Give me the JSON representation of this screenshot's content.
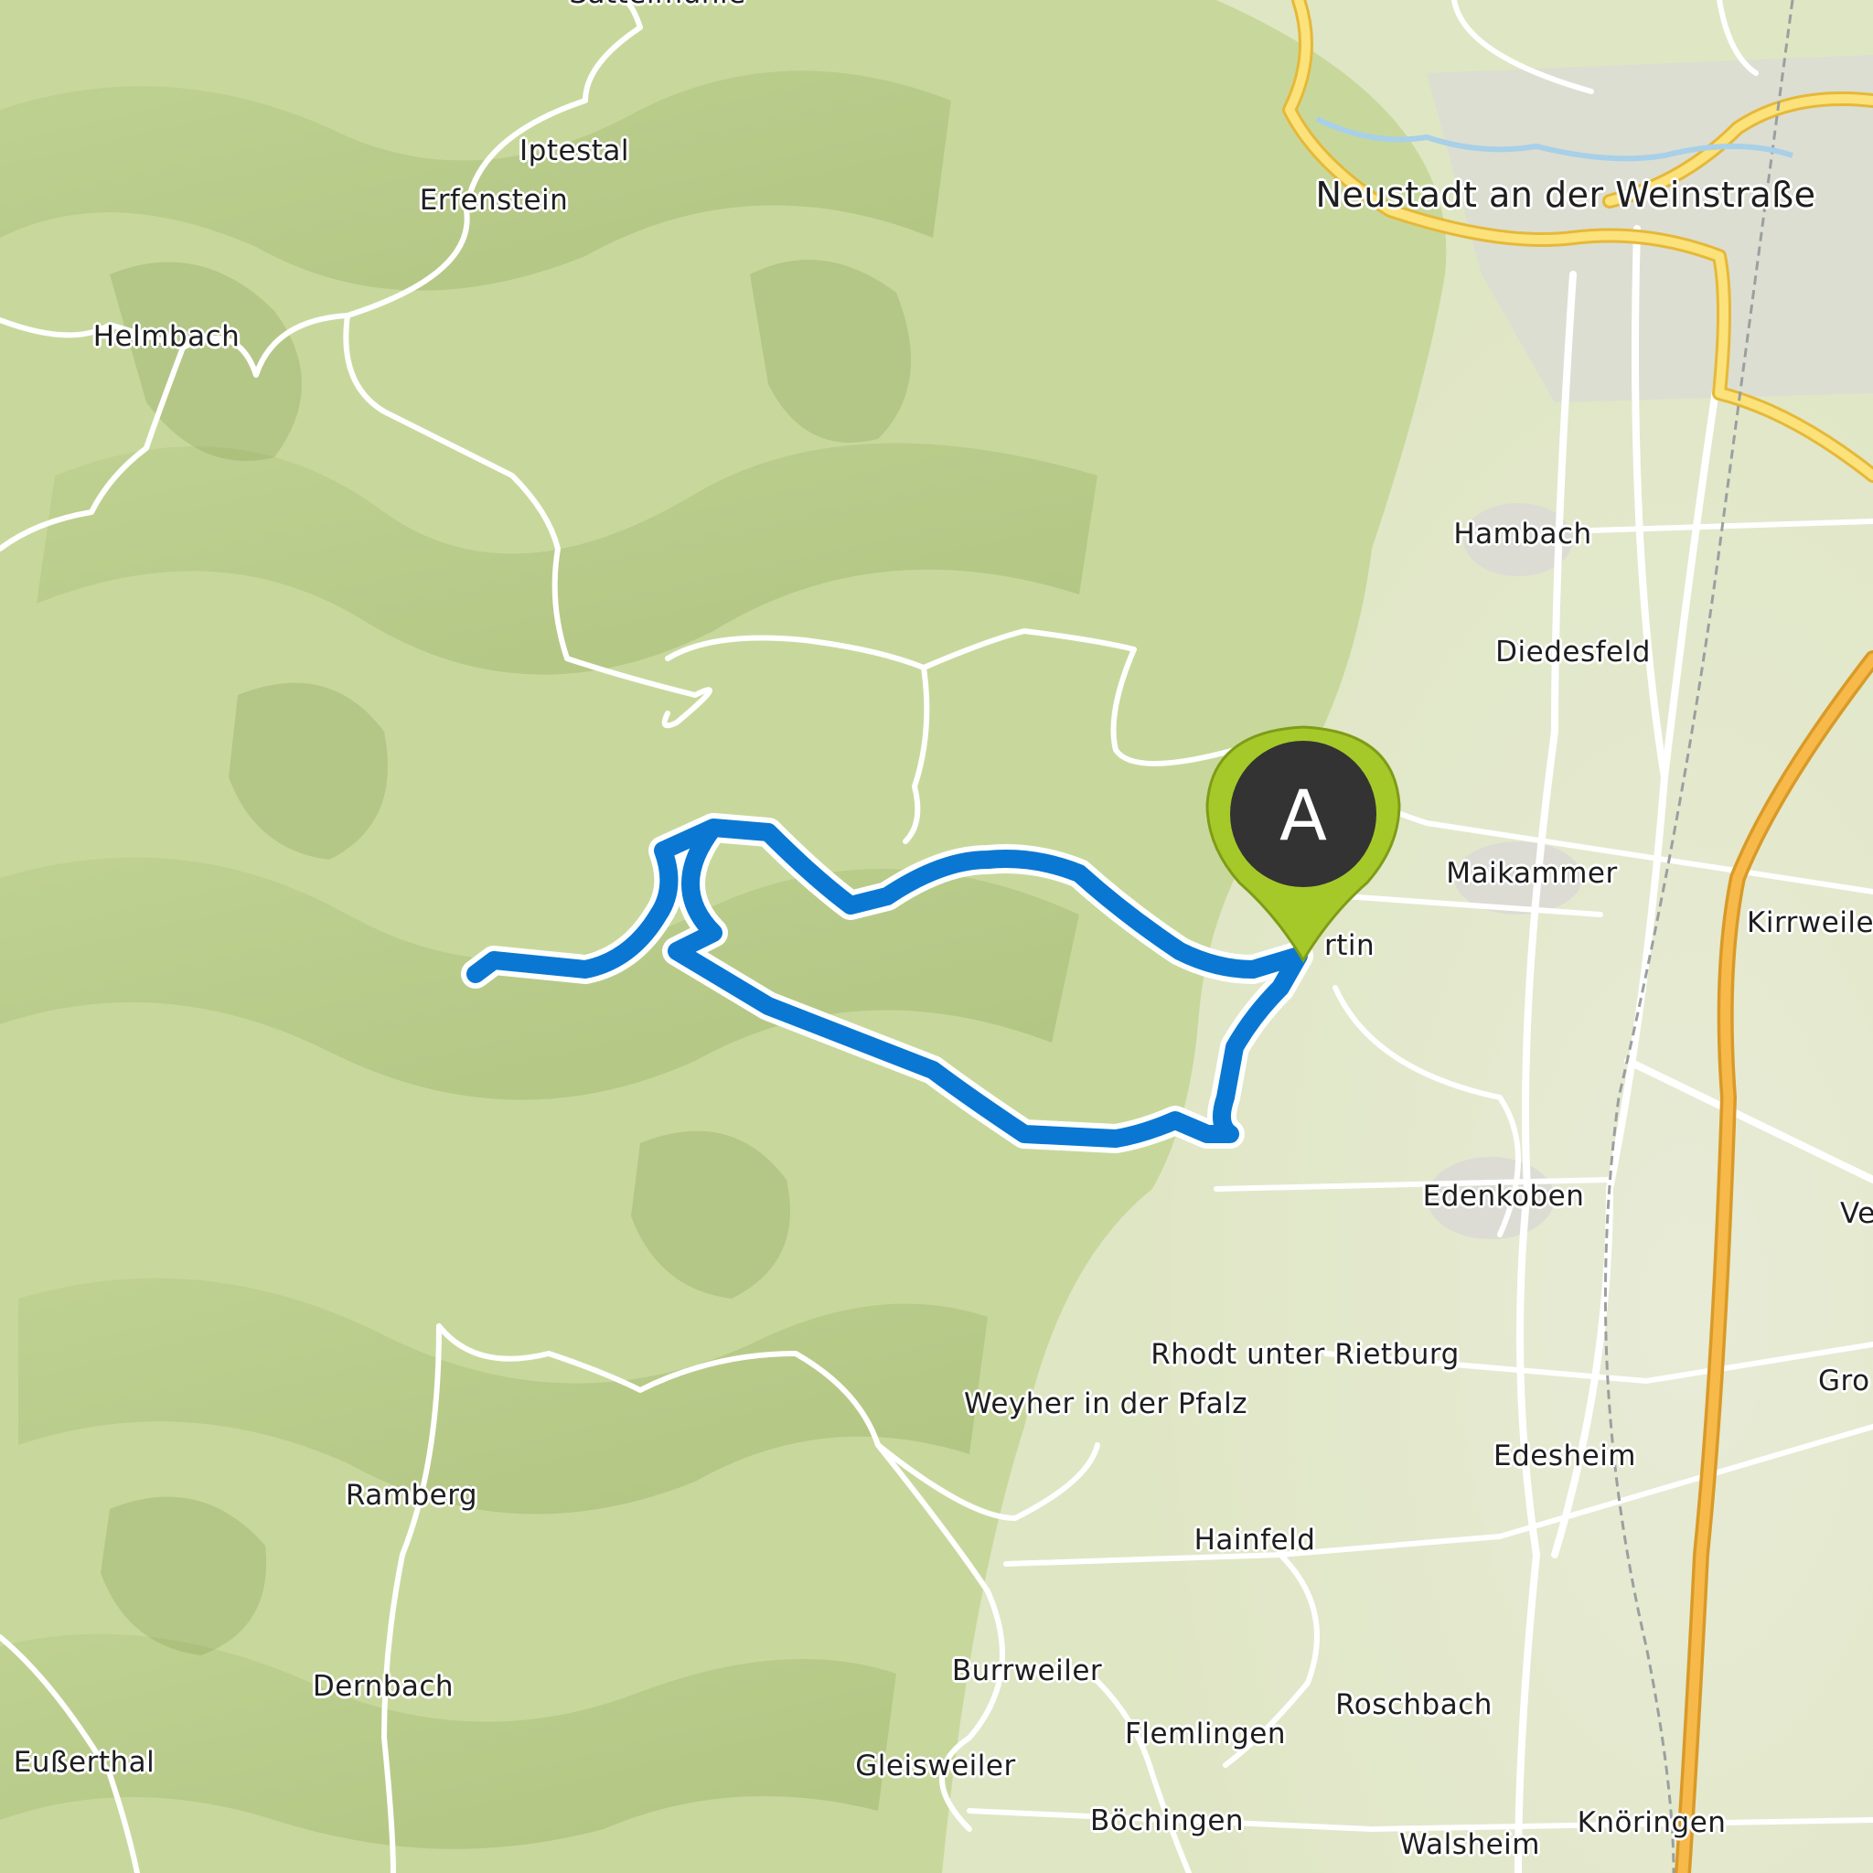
{
  "map": {
    "route_color": "#0a78d2",
    "marker": {
      "letter": "A",
      "color": "#a6c92a",
      "inner_color": "#333333"
    },
    "colors": {
      "forest": "#c7d79a",
      "lowland": "#e4e8cd",
      "road_major": "#f8d25c",
      "motorway": "#f3b43c",
      "road_minor": "#ffffff"
    },
    "places": [
      {
        "key": "sattelmuhle",
        "name": "Sattelmühle"
      },
      {
        "key": "iptestal",
        "name": "Iptestal"
      },
      {
        "key": "erfenstein",
        "name": "Erfenstein"
      },
      {
        "key": "helmbach",
        "name": "Helmbach"
      },
      {
        "key": "neustadt",
        "name": "Neustadt an der Weinstraße"
      },
      {
        "key": "hambach",
        "name": "Hambach"
      },
      {
        "key": "diedesfeld",
        "name": "Diedesfeld"
      },
      {
        "key": "maikammer",
        "name": "Maikammer"
      },
      {
        "key": "kirrweiler",
        "name": "Kirrweile"
      },
      {
        "key": "stmartin",
        "name": "rtin"
      },
      {
        "key": "edenkoben",
        "name": "Edenkoben"
      },
      {
        "key": "ve",
        "name": "Ve"
      },
      {
        "key": "rhodt",
        "name": "Rhodt unter Rietburg"
      },
      {
        "key": "gro",
        "name": "Gro"
      },
      {
        "key": "weyher",
        "name": "Weyher in der Pfalz"
      },
      {
        "key": "edesheim",
        "name": "Edesheim"
      },
      {
        "key": "ramberg",
        "name": "Ramberg"
      },
      {
        "key": "hainfeld",
        "name": "Hainfeld"
      },
      {
        "key": "burrweiler",
        "name": "Burrweiler"
      },
      {
        "key": "roschbach",
        "name": "Roschbach"
      },
      {
        "key": "dernbach",
        "name": "Dernbach"
      },
      {
        "key": "flemlingen",
        "name": "Flemlingen"
      },
      {
        "key": "eusserthal",
        "name": "Eußerthal"
      },
      {
        "key": "gleisweiler",
        "name": "Gleisweiler"
      },
      {
        "key": "bochingen",
        "name": "Böchingen"
      },
      {
        "key": "knoringen",
        "name": "Knöringen"
      },
      {
        "key": "walsheim",
        "name": "Walsheim"
      }
    ]
  }
}
